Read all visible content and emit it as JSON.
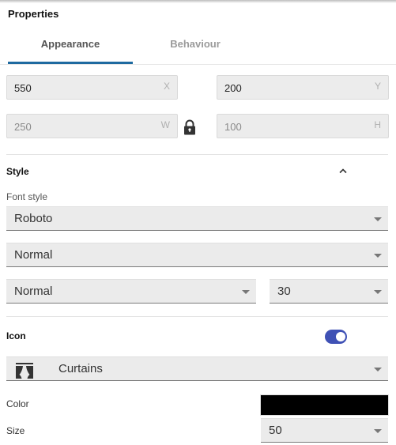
{
  "panel": {
    "title": "Properties"
  },
  "tabs": [
    {
      "label": "Appearance",
      "active": true
    },
    {
      "label": "Behaviour",
      "active": false
    }
  ],
  "position": {
    "x": {
      "value": "550",
      "suffix": "X"
    },
    "y": {
      "value": "200",
      "suffix": "Y"
    },
    "w": {
      "value": "250",
      "suffix": "W"
    },
    "h": {
      "value": "100",
      "suffix": "H"
    },
    "lock_icon": "lock-icon"
  },
  "style": {
    "title": "Style",
    "collapse_icon": "chevron-up-icon",
    "font_style_label": "Font style",
    "font_family": "Roboto",
    "font_weight": "Normal",
    "font_variant": "Normal",
    "font_size": "30"
  },
  "icon": {
    "title": "Icon",
    "enabled": true,
    "toggle_color": "#3f51b5",
    "selected_icon": "Curtains",
    "selected_icon_glyph": "curtains-icon",
    "color_label": "Color",
    "color_value": "#000000",
    "size_label": "Size",
    "size_value": "50"
  },
  "colors": {
    "tab_indicator": "#1e6aa0",
    "field_background": "#ececec"
  }
}
